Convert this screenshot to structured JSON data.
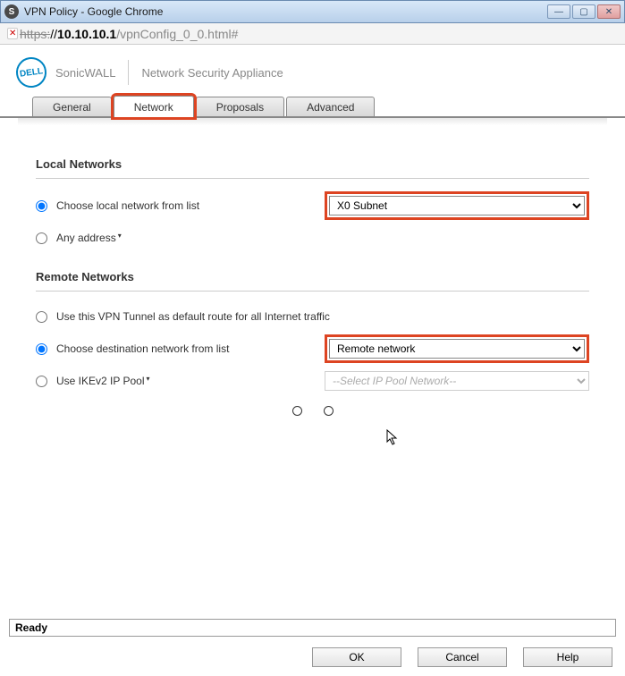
{
  "window": {
    "title": "VPN Policy - Google Chrome"
  },
  "address": {
    "protocol": "https:",
    "sep": "//",
    "host": "10.10.10.1",
    "path": "/vpnConfig_0_0.html#"
  },
  "brand": {
    "logo": "DELL",
    "name": "SonicWALL",
    "sub": "Network Security Appliance"
  },
  "tabs": {
    "general": "General",
    "network": "Network",
    "proposals": "Proposals",
    "advanced": "Advanced"
  },
  "sections": {
    "local": {
      "title": "Local Networks",
      "opt_list": "Choose local network from list",
      "opt_any": "Any address",
      "select_value": "X0 Subnet"
    },
    "remote": {
      "title": "Remote Networks",
      "opt_default": "Use this VPN Tunnel as default route for all Internet traffic",
      "opt_list": "Choose destination network from list",
      "opt_ike": "Use IKEv2 IP Pool",
      "select_value": "Remote network",
      "pool_value": "--Select IP Pool Network--"
    }
  },
  "status": "Ready",
  "footer": {
    "ok": "OK",
    "cancel": "Cancel",
    "help": "Help"
  }
}
